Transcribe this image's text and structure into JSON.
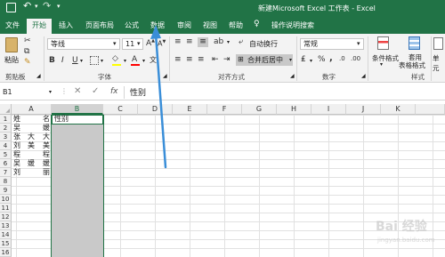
{
  "window": {
    "title": "新建Microsoft Excel 工作表 - Excel"
  },
  "qat": {
    "save_icon": "save-icon",
    "undo_icon": "undo-icon",
    "redo_icon": "redo-icon"
  },
  "tabs": [
    {
      "label": "文件"
    },
    {
      "label": "开始"
    },
    {
      "label": "插入"
    },
    {
      "label": "页面布局"
    },
    {
      "label": "公式"
    },
    {
      "label": "数据"
    },
    {
      "label": "审阅"
    },
    {
      "label": "视图"
    },
    {
      "label": "帮助"
    }
  ],
  "tellme": {
    "label": "操作说明搜索"
  },
  "ribbon": {
    "clipboard": {
      "paste_label": "粘贴",
      "group_label": "剪贴板"
    },
    "font": {
      "font_name": "等线",
      "font_size": "11",
      "group_label": "字体",
      "color_swatch": "#ffff00",
      "font_color": "#ff0000"
    },
    "align": {
      "wrap_label": "自动换行",
      "merge_label": "合并后居中",
      "group_label": "对齐方式"
    },
    "number": {
      "format": "常规",
      "pct": "%",
      "comma": ",",
      "group_label": "数字"
    },
    "styles": {
      "cond_label": "条件格式",
      "table_label": "套用",
      "table_label2": "表格格式",
      "group_label": "样式"
    },
    "cells": {
      "label": "单元"
    }
  },
  "formula_bar": {
    "name_box": "B1",
    "fx": "fx",
    "value": "性别"
  },
  "columns": [
    "A",
    "B",
    "C",
    "D",
    "E",
    "F",
    "G",
    "H",
    "I",
    "J",
    "K"
  ],
  "rows": [
    "1",
    "2",
    "3",
    "4",
    "5",
    "6",
    "7",
    "8",
    "9",
    "10",
    "11",
    "12",
    "13",
    "14",
    "15",
    "16"
  ],
  "cells": {
    "a": [
      {
        "l": "姓",
        "r": "名"
      },
      {
        "l": "吴",
        "r": "媛"
      },
      {
        "l": "张",
        "m": "大",
        "r": "大"
      },
      {
        "l": "刘",
        "m": "美",
        "r": "美"
      },
      {
        "l": "程",
        "r": "程"
      },
      {
        "l": "吴",
        "m": "媛",
        "r": "媛"
      },
      {
        "l": "刘",
        "r": "丽"
      }
    ],
    "b1": "性别"
  },
  "watermark": {
    "text": "Bai 经验",
    "sub": "jingyan.baidu.com"
  },
  "accent": "#217346",
  "arrow_color": "#3a8ed8"
}
